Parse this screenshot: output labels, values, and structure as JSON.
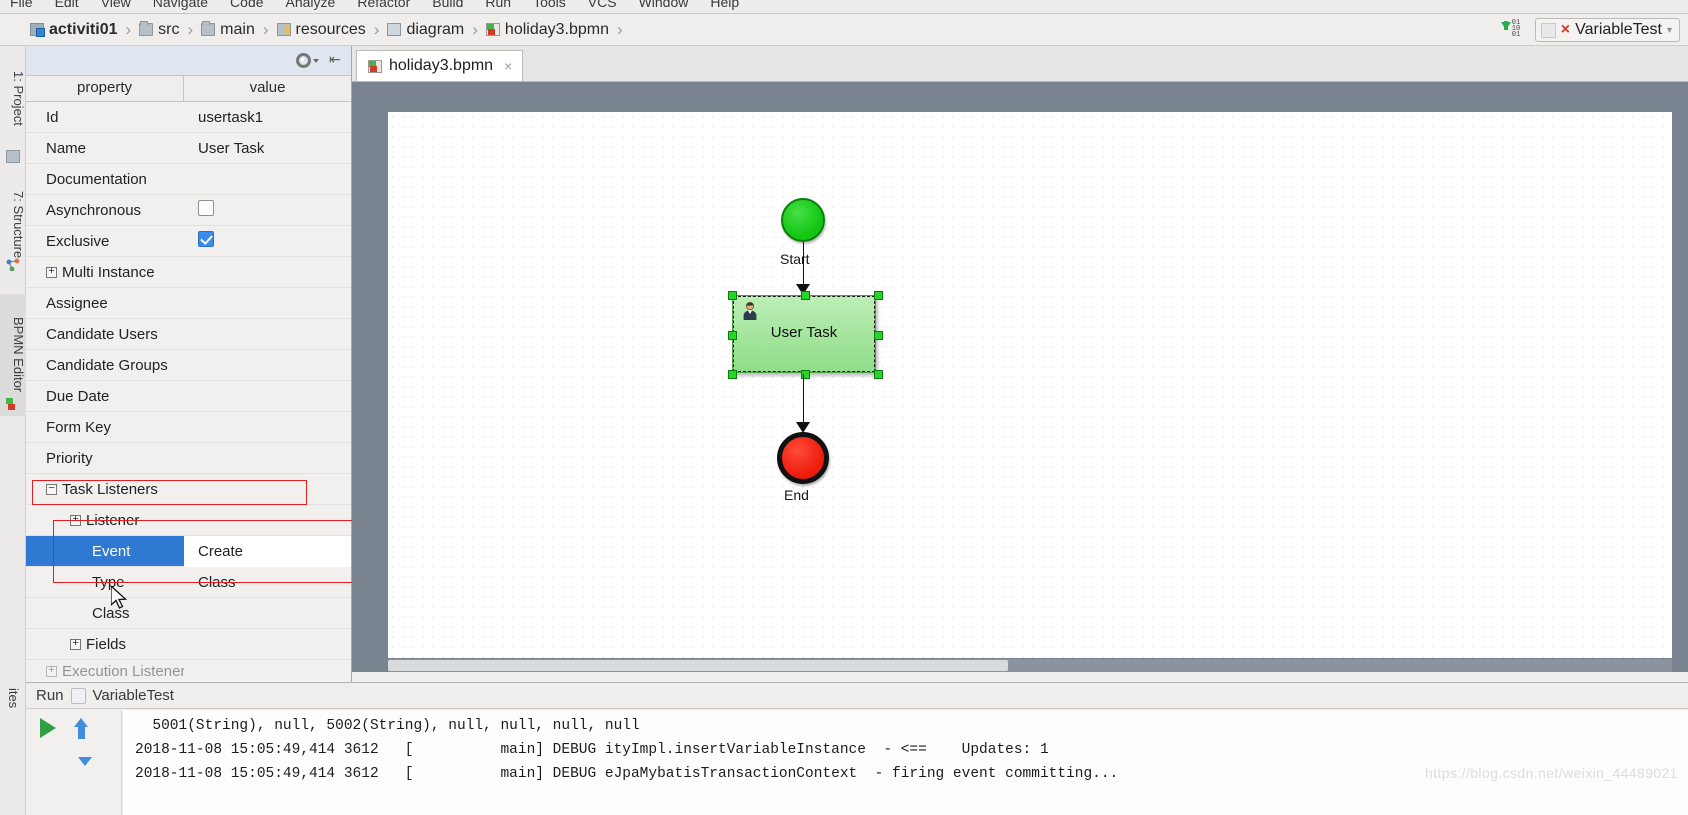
{
  "menu": {
    "items": [
      "File",
      "Edit",
      "View",
      "Navigate",
      "Code",
      "Analyze",
      "Refactor",
      "Build",
      "Run",
      "Tools",
      "VCS",
      "Window",
      "Help"
    ]
  },
  "breadcrumb": {
    "items": [
      {
        "label": "activiti01",
        "icon": "module-icon",
        "bold": true
      },
      {
        "label": "src",
        "icon": "folder-icon",
        "bold": false
      },
      {
        "label": "main",
        "icon": "folder-icon",
        "bold": false
      },
      {
        "label": "resources",
        "icon": "resources-folder-icon",
        "bold": false
      },
      {
        "label": "diagram",
        "icon": "folder-open-icon",
        "bold": false
      },
      {
        "label": "holiday3.bpmn",
        "icon": "bpmn-file-icon",
        "bold": false
      }
    ],
    "separator": "›"
  },
  "toolbar_right": {
    "download_icon": "download-bits-icon",
    "bits": [
      "01",
      "10",
      "01"
    ],
    "run_config": {
      "name": "VariableTest",
      "status_mark": "×",
      "caret": "▾"
    }
  },
  "left_tool_tabs": [
    {
      "label": "1: Project",
      "active": false,
      "icon": "project-icon"
    },
    {
      "label": "7: Structure",
      "active": false,
      "icon": "structure-icon"
    },
    {
      "label": "BPMN Editor",
      "active": true,
      "icon": "bpmn-editor-icon"
    }
  ],
  "bottom_tool_tab": {
    "label": "ites",
    "icon": "favorites-icon"
  },
  "properties_panel": {
    "toolbar": {
      "settings_icon": "gear-icon",
      "collapse_icon": "collapse-all-icon"
    },
    "columns": [
      "property",
      "value"
    ],
    "rows": [
      {
        "key": "Id",
        "value": "usertask1",
        "indent": 1,
        "type": "text"
      },
      {
        "key": "Name",
        "value": "User Task",
        "indent": 1,
        "type": "text"
      },
      {
        "key": "Documentation",
        "value": "",
        "indent": 1,
        "type": "text"
      },
      {
        "key": "Asynchronous",
        "value": "",
        "indent": 1,
        "type": "checkbox",
        "checked": false
      },
      {
        "key": "Exclusive",
        "value": "",
        "indent": 1,
        "type": "checkbox",
        "checked": true
      },
      {
        "key": "Multi Instance",
        "value": "",
        "indent": 0,
        "type": "tree",
        "expander": "+"
      },
      {
        "key": "Assignee",
        "value": "",
        "indent": 1,
        "type": "text"
      },
      {
        "key": "Candidate Users",
        "value": "",
        "indent": 1,
        "type": "text"
      },
      {
        "key": "Candidate Groups",
        "value": "",
        "indent": 1,
        "type": "text"
      },
      {
        "key": "Due Date",
        "value": "",
        "indent": 1,
        "type": "text"
      },
      {
        "key": "Form Key",
        "value": "",
        "indent": 1,
        "type": "text"
      },
      {
        "key": "Priority",
        "value": "",
        "indent": 1,
        "type": "text"
      },
      {
        "key": "Task Listeners",
        "value": "",
        "indent": 0,
        "type": "tree",
        "expander": "−",
        "highlighted": true
      },
      {
        "key": "Listener",
        "value": "",
        "indent": 2,
        "type": "tree",
        "expander": "+"
      },
      {
        "key": "Event",
        "value": "Create",
        "indent": 3,
        "type": "text",
        "selected": true
      },
      {
        "key": "Type",
        "value": "Class",
        "indent": 3,
        "type": "text"
      },
      {
        "key": "Class",
        "value": "",
        "indent": 3,
        "type": "text"
      },
      {
        "key": "Fields",
        "value": "",
        "indent": 2,
        "type": "tree",
        "expander": "+"
      },
      {
        "key": "Execution Listeners",
        "value": "",
        "indent": 0,
        "type": "tree",
        "expander": "+",
        "clipped": true
      }
    ]
  },
  "editor": {
    "tabs": [
      {
        "label": "holiday3.bpmn",
        "icon": "bpmn-file-icon",
        "close": "×",
        "active": true
      }
    ]
  },
  "diagram": {
    "nodes": [
      {
        "id": "start",
        "type": "start-event",
        "label": "Start"
      },
      {
        "id": "usertask1",
        "type": "user-task",
        "label": "User Task",
        "selected": true
      },
      {
        "id": "end",
        "type": "end-event",
        "label": "End"
      }
    ],
    "colors": {
      "start_fill": "#12c512",
      "end_fill": "#ee1c0c",
      "task_fill": "#8fdd89",
      "handle": "#27d427"
    }
  },
  "run_panel": {
    "title": "Run",
    "config_name": "VariableTest",
    "buttons": [
      "rerun-button",
      "scroll-up-button",
      "scroll-down-button"
    ],
    "console_lines": [
      "  5001(String), null, 5002(String), null, null, null, null",
      "2018-11-08 15:05:49,414 3612   [          main] DEBUG ityImpl.insertVariableInstance  - <==    Updates: 1",
      "2018-11-08 15:05:49,414 3612   [          main] DEBUG eJpaMybatisTransactionContext  - firing event committing..."
    ],
    "watermark": "https://blog.csdn.net/weixin_44489021"
  }
}
